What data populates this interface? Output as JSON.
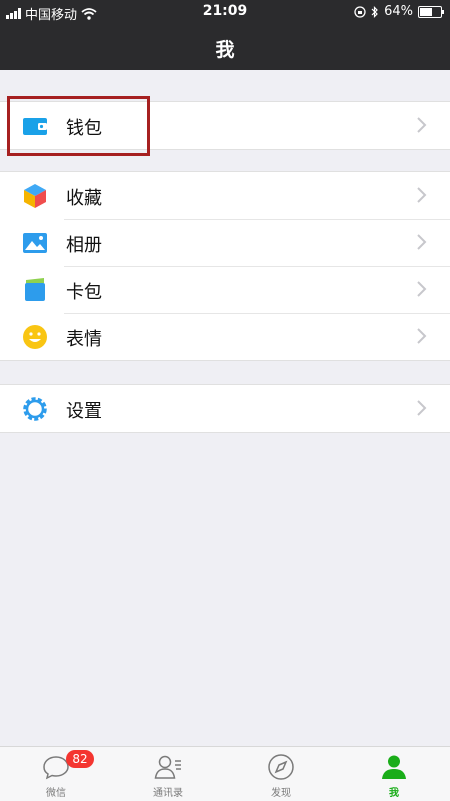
{
  "status_bar": {
    "carrier": "中国移动",
    "time": "21:09",
    "battery": "64%",
    "battery_level": 0.64
  },
  "nav": {
    "title": "我"
  },
  "groups": [
    {
      "items": [
        {
          "label": "钱包",
          "icon": "wallet-icon"
        }
      ]
    },
    {
      "items": [
        {
          "label": "收藏",
          "icon": "favorites-cube-icon"
        },
        {
          "label": "相册",
          "icon": "album-picture-icon"
        },
        {
          "label": "卡包",
          "icon": "card-pack-icon"
        },
        {
          "label": "表情",
          "icon": "smiley-icon"
        }
      ]
    },
    {
      "items": [
        {
          "label": "设置",
          "icon": "settings-gear-icon"
        }
      ]
    }
  ],
  "tabbar": {
    "tabs": [
      {
        "label": "微信",
        "icon": "chat-bubble-icon",
        "badge": "82"
      },
      {
        "label": "通讯录",
        "icon": "contacts-icon"
      },
      {
        "label": "发现",
        "icon": "compass-icon"
      },
      {
        "label": "我",
        "icon": "me-person-icon",
        "active": true
      }
    ]
  },
  "colors": {
    "header_bg": "#2b2b2d",
    "accent_green": "#1aad19",
    "badge_red": "#f43530",
    "highlight_box": "#a62020"
  }
}
